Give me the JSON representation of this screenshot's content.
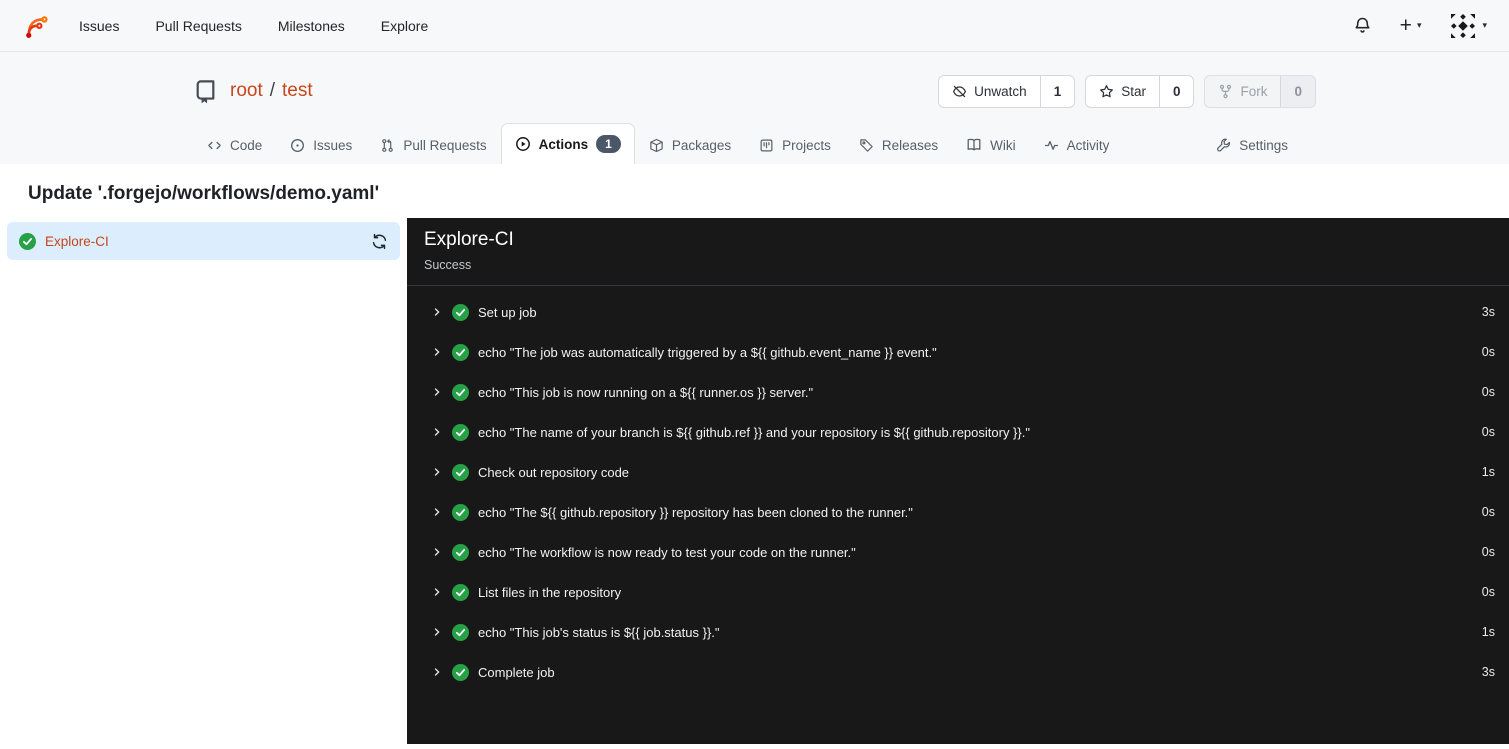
{
  "colors": {
    "accent": "#c7461d",
    "success": "#26a148",
    "panel_bg": "#181818",
    "selected_job_bg": "#dceefd",
    "badge_bg": "#4b5668"
  },
  "navbar": {
    "items": [
      {
        "label": "Issues"
      },
      {
        "label": "Pull Requests"
      },
      {
        "label": "Milestones"
      },
      {
        "label": "Explore"
      }
    ]
  },
  "repo": {
    "owner": "root",
    "separator": "/",
    "name": "test",
    "actions": {
      "watch": {
        "label": "Unwatch",
        "count": "1"
      },
      "star": {
        "label": "Star",
        "count": "0"
      },
      "fork": {
        "label": "Fork",
        "count": "0",
        "disabled": true
      }
    },
    "tabs": [
      {
        "label": "Code"
      },
      {
        "label": "Issues"
      },
      {
        "label": "Pull Requests"
      },
      {
        "label": "Actions",
        "badge": "1",
        "active": true
      },
      {
        "label": "Packages"
      },
      {
        "label": "Projects"
      },
      {
        "label": "Releases"
      },
      {
        "label": "Wiki"
      },
      {
        "label": "Activity"
      },
      {
        "label": "Settings"
      }
    ]
  },
  "run": {
    "title": "Update '.forgejo/workflows/demo.yaml'",
    "sidebar_job": {
      "label": "Explore-CI",
      "status": "success"
    },
    "job_header": {
      "name": "Explore-CI",
      "status_text": "Success"
    },
    "steps": [
      {
        "label": "Set up job",
        "duration": "3s"
      },
      {
        "label": "echo \"The job was automatically triggered by a ${{ github.event_name }} event.\"",
        "duration": "0s"
      },
      {
        "label": "echo \"This job is now running on a ${{ runner.os }} server.\"",
        "duration": "0s"
      },
      {
        "label": "echo \"The name of your branch is ${{ github.ref }} and your repository is ${{ github.repository }}.\"",
        "duration": "0s"
      },
      {
        "label": "Check out repository code",
        "duration": "1s"
      },
      {
        "label": "echo \"The ${{ github.repository }} repository has been cloned to the runner.\"",
        "duration": "0s"
      },
      {
        "label": "echo \"The workflow is now ready to test your code on the runner.\"",
        "duration": "0s"
      },
      {
        "label": "List files in the repository",
        "duration": "0s"
      },
      {
        "label": "echo \"This job's status is ${{ job.status }}.\"",
        "duration": "1s"
      },
      {
        "label": "Complete job",
        "duration": "3s"
      }
    ]
  }
}
